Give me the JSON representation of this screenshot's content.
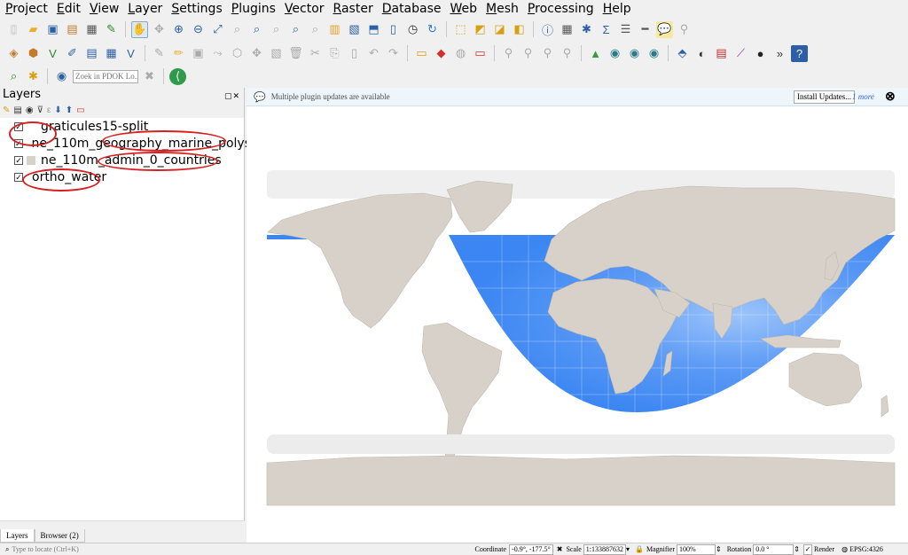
{
  "menu": [
    "Project",
    "Edit",
    "View",
    "Layer",
    "Settings",
    "Plugins",
    "Vector",
    "Raster",
    "Database",
    "Web",
    "Mesh",
    "Processing",
    "Help"
  ],
  "toolbar3": {
    "locator_placeholder": "Zoek in PDOK Lo..."
  },
  "layers_panel": {
    "title": "Layers",
    "layers": [
      {
        "name": "graticules15-split",
        "checked": "✓"
      },
      {
        "name": "ne_110m_geography_marine_polys",
        "checked": "✓"
      },
      {
        "name": "ne_110m_admin_0_countries",
        "checked": "✓"
      },
      {
        "name": "ortho_water",
        "checked": "✓"
      }
    ],
    "tabs": [
      "Layers",
      "Browser (2)"
    ]
  },
  "message_bar": {
    "text": "Multiple plugin updates are available",
    "install_button": "Install Updates...",
    "more_link": "1 more"
  },
  "status_bar": {
    "locate_placeholder": "Type to locate (Ctrl+K)",
    "coordinate_label": "Coordinate",
    "coordinate_value": "-0.9°, -177.5°",
    "scale_label": "Scale",
    "scale_value": "1:133887632",
    "magnifier_label": "Magnifier",
    "magnifier_value": "100%",
    "rotation_label": "Rotation",
    "rotation_value": "0.0 °",
    "render_label": "Render",
    "crs": "EPSG:4326"
  },
  "colors": {
    "land": "#d7d1c9",
    "ocean_fill": "#3b86f2",
    "ice": "#ececec",
    "annotation": "#d61f1f",
    "link": "#3366cc"
  }
}
